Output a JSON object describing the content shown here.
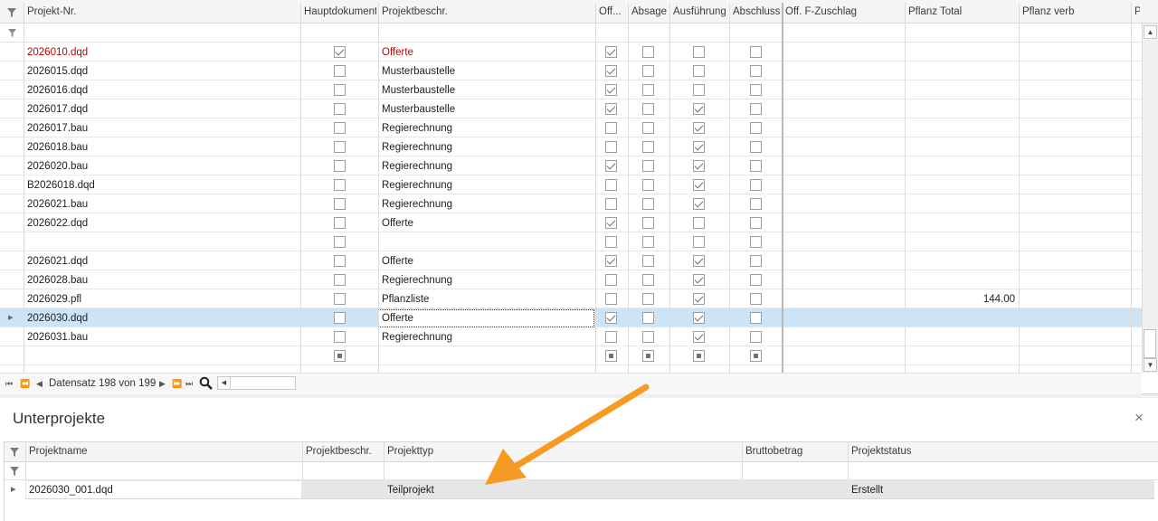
{
  "top_grid": {
    "columns": [
      "Projekt-Nr.",
      "Hauptdokument",
      "Projektbeschr.",
      "Off...",
      "Absage",
      "Ausführung",
      "Abschluss",
      "Off. F-Zuschlag",
      "Pflanz Total",
      "Pflanz verb",
      "Pflanz"
    ],
    "rows": [
      {
        "nr": "2026010.dqd",
        "haupt": "checked",
        "beschr": "Offerte",
        "off": "checked",
        "absage": "",
        "ausf": "",
        "abschl": "",
        "zuschlag": "",
        "pflanz_total": "",
        "red": true
      },
      {
        "nr": "2026015.dqd",
        "haupt": "",
        "beschr": "Musterbaustelle",
        "off": "checked",
        "absage": "",
        "ausf": "",
        "abschl": "",
        "zuschlag": "",
        "pflanz_total": ""
      },
      {
        "nr": "2026016.dqd",
        "haupt": "",
        "beschr": "Musterbaustelle",
        "off": "checked",
        "absage": "",
        "ausf": "",
        "abschl": "",
        "zuschlag": "",
        "pflanz_total": ""
      },
      {
        "nr": "2026017.dqd",
        "haupt": "",
        "beschr": "Musterbaustelle",
        "off": "checked",
        "absage": "",
        "ausf": "checked",
        "abschl": "",
        "zuschlag": "",
        "pflanz_total": ""
      },
      {
        "nr": "2026017.bau",
        "haupt": "",
        "beschr": "Regierechnung",
        "off": "",
        "absage": "",
        "ausf": "checked",
        "abschl": "",
        "zuschlag": "",
        "pflanz_total": ""
      },
      {
        "nr": "2026018.bau",
        "haupt": "",
        "beschr": "Regierechnung",
        "off": "",
        "absage": "",
        "ausf": "checked",
        "abschl": "",
        "zuschlag": "",
        "pflanz_total": ""
      },
      {
        "nr": "2026020.bau",
        "haupt": "",
        "beschr": "Regierechnung",
        "off": "checked",
        "absage": "",
        "ausf": "checked",
        "abschl": "",
        "zuschlag": "",
        "pflanz_total": ""
      },
      {
        "nr": "B2026018.dqd",
        "haupt": "",
        "beschr": "Regierechnung",
        "off": "",
        "absage": "",
        "ausf": "checked",
        "abschl": "",
        "zuschlag": "",
        "pflanz_total": ""
      },
      {
        "nr": "2026021.bau",
        "haupt": "",
        "beschr": "Regierechnung",
        "off": "",
        "absage": "",
        "ausf": "checked",
        "abschl": "",
        "zuschlag": "",
        "pflanz_total": ""
      },
      {
        "nr": "2026022.dqd",
        "haupt": "",
        "beschr": "Offerte",
        "off": "checked",
        "absage": "",
        "ausf": "",
        "abschl": "",
        "zuschlag": "",
        "pflanz_total": ""
      },
      {
        "nr": "",
        "haupt": "",
        "beschr": "",
        "off": "",
        "absage": "",
        "ausf": "",
        "abschl": "",
        "zuschlag": "",
        "pflanz_total": ""
      },
      {
        "nr": "2026021.dqd",
        "haupt": "",
        "beschr": "Offerte",
        "off": "checked",
        "absage": "",
        "ausf": "checked",
        "abschl": "",
        "zuschlag": "",
        "pflanz_total": ""
      },
      {
        "nr": "2026028.bau",
        "haupt": "",
        "beschr": "Regierechnung",
        "off": "",
        "absage": "",
        "ausf": "checked",
        "abschl": "",
        "zuschlag": "",
        "pflanz_total": ""
      },
      {
        "nr": "2026029.pfl",
        "haupt": "",
        "beschr": "Pflanzliste",
        "off": "",
        "absage": "",
        "ausf": "checked",
        "abschl": "",
        "zuschlag": "",
        "pflanz_total": "144.00"
      },
      {
        "nr": "2026030.dqd",
        "haupt": "",
        "beschr": "Offerte",
        "off": "checked",
        "absage": "",
        "ausf": "checked",
        "abschl": "",
        "zuschlag": "",
        "pflanz_total": "",
        "selected": true
      },
      {
        "nr": "2026031.bau",
        "haupt": "",
        "beschr": "Regierechnung",
        "off": "",
        "absage": "",
        "ausf": "checked",
        "abschl": "",
        "zuschlag": "",
        "pflanz_total": ""
      },
      {
        "nr": "",
        "haupt": "indet",
        "beschr": "",
        "off": "indet",
        "absage": "indet",
        "ausf": "indet",
        "abschl": "indet",
        "zuschlag": "",
        "pflanz_total": ""
      }
    ],
    "navigator": {
      "status": "Datensatz 198 von 199"
    }
  },
  "sub_panel": {
    "title": "Unterprojekte",
    "close_glyph": "×",
    "columns": [
      "Projektname",
      "Projektbeschr.",
      "Projekttyp",
      "Bruttobetrag",
      "Projektstatus"
    ],
    "rows": [
      {
        "projektname": "2026030_001.dqd",
        "beschr": "",
        "typ": "Teilprojekt",
        "brutto": "",
        "status": "Erstellt"
      }
    ]
  },
  "colors": {
    "accent_arrow": "#f59a23",
    "selection": "#cde4f7",
    "red_text": "#c00000"
  }
}
